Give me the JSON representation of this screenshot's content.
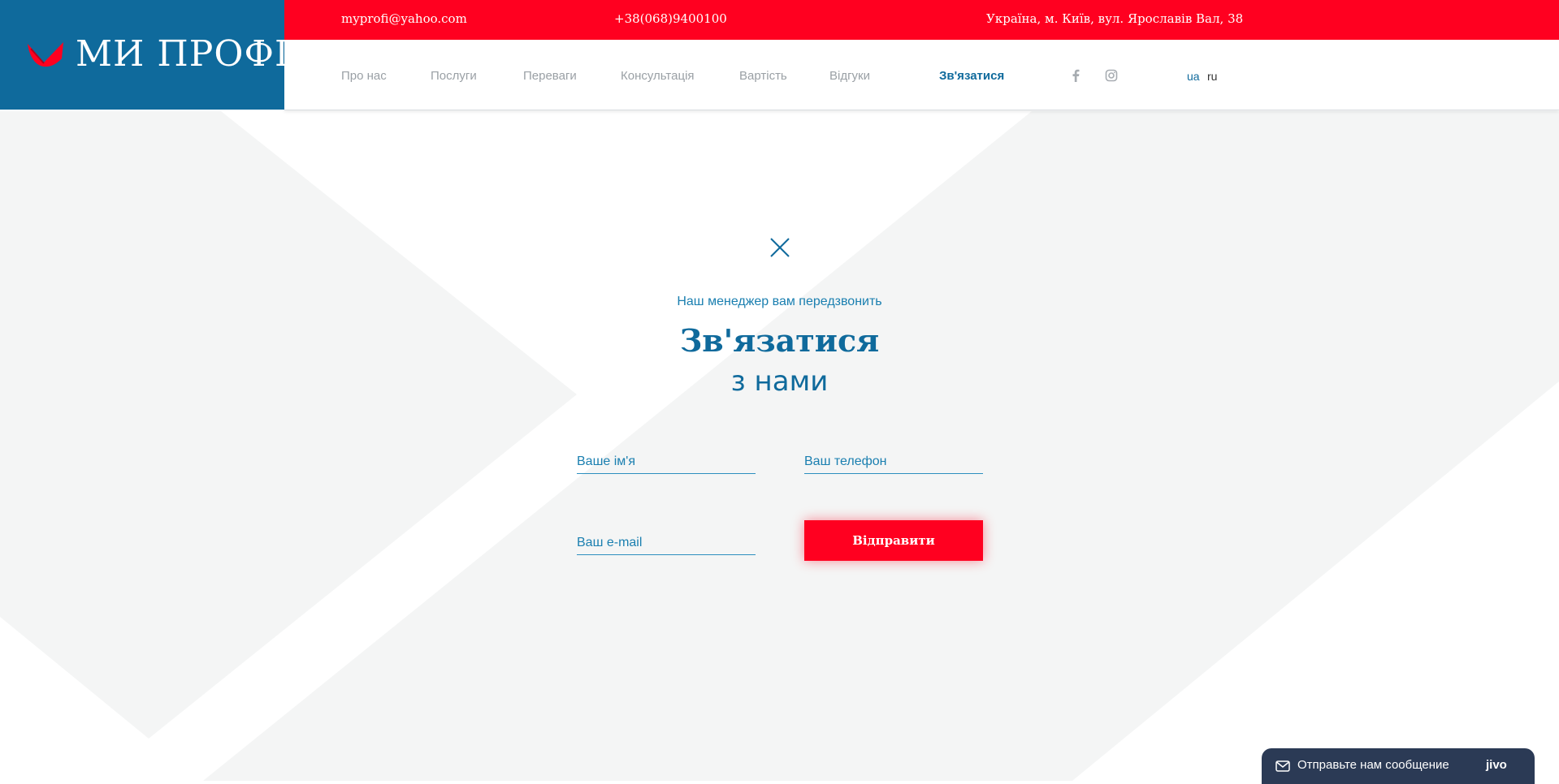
{
  "topbar": {
    "email": "myprofi@yahoo.com",
    "phone": "+38(068)9400100",
    "address": "Україна, м. Київ, вул. Ярославів Вал, 38"
  },
  "logo": {
    "text": "МИ ПРОФІ",
    "icon": "wings-icon"
  },
  "nav": {
    "items": [
      {
        "label": "Про нас"
      },
      {
        "label": "Послуги"
      },
      {
        "label": "Переваги"
      },
      {
        "label": "Консультація"
      },
      {
        "label": "Вартість"
      },
      {
        "label": "Відгуки"
      }
    ],
    "contact_label": "Зв'язатися",
    "social": [
      "facebook-icon",
      "instagram-icon"
    ],
    "languages": [
      "ua",
      "ru"
    ]
  },
  "form": {
    "close_icon": "close-icon",
    "subtitle": "Наш менеджер вам передзвонить",
    "title_line1": "Зв'язатися",
    "title_line2": "з нами",
    "name_placeholder": "Ваше ім'я",
    "phone_placeholder": "Ваш телефон",
    "email_placeholder": "Ваш e-mail",
    "submit_label": "Відправити"
  },
  "chat": {
    "message": "Отправьте нам сообщение",
    "brand": "jivo",
    "icon": "envelope-icon"
  },
  "colors": {
    "brand_blue": "#0f6a9c",
    "accent_red": "#ff0020",
    "background_shape": "#f4f5f5",
    "chat_bg": "#2b3a55"
  }
}
